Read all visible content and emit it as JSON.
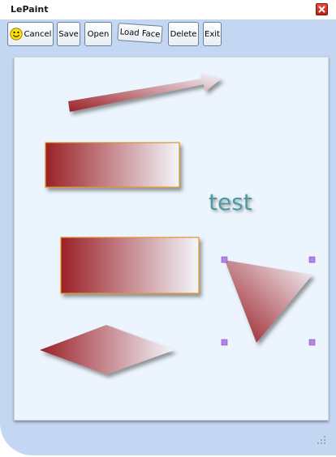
{
  "window": {
    "title": "LePaint"
  },
  "toolbar": {
    "cancel_label": "Cancel",
    "save_label": "Save",
    "open_label": "Open",
    "load_face_label": "Load Face",
    "delete_label": "Delete",
    "exit_label": "Exit"
  },
  "canvas": {
    "text_shape": "test"
  },
  "icons": {
    "close": "close-icon",
    "smiley": "smiley-icon",
    "resize_grip": "resize-grip-icon"
  },
  "colors": {
    "shape_dark": "#9b2027",
    "shape_light": "#f3f6fb",
    "text_shape": "#4e9aa4",
    "handle": "#b584e8",
    "window_bg": "#c3d7f2",
    "canvas_bg": "#ecf5fd"
  }
}
